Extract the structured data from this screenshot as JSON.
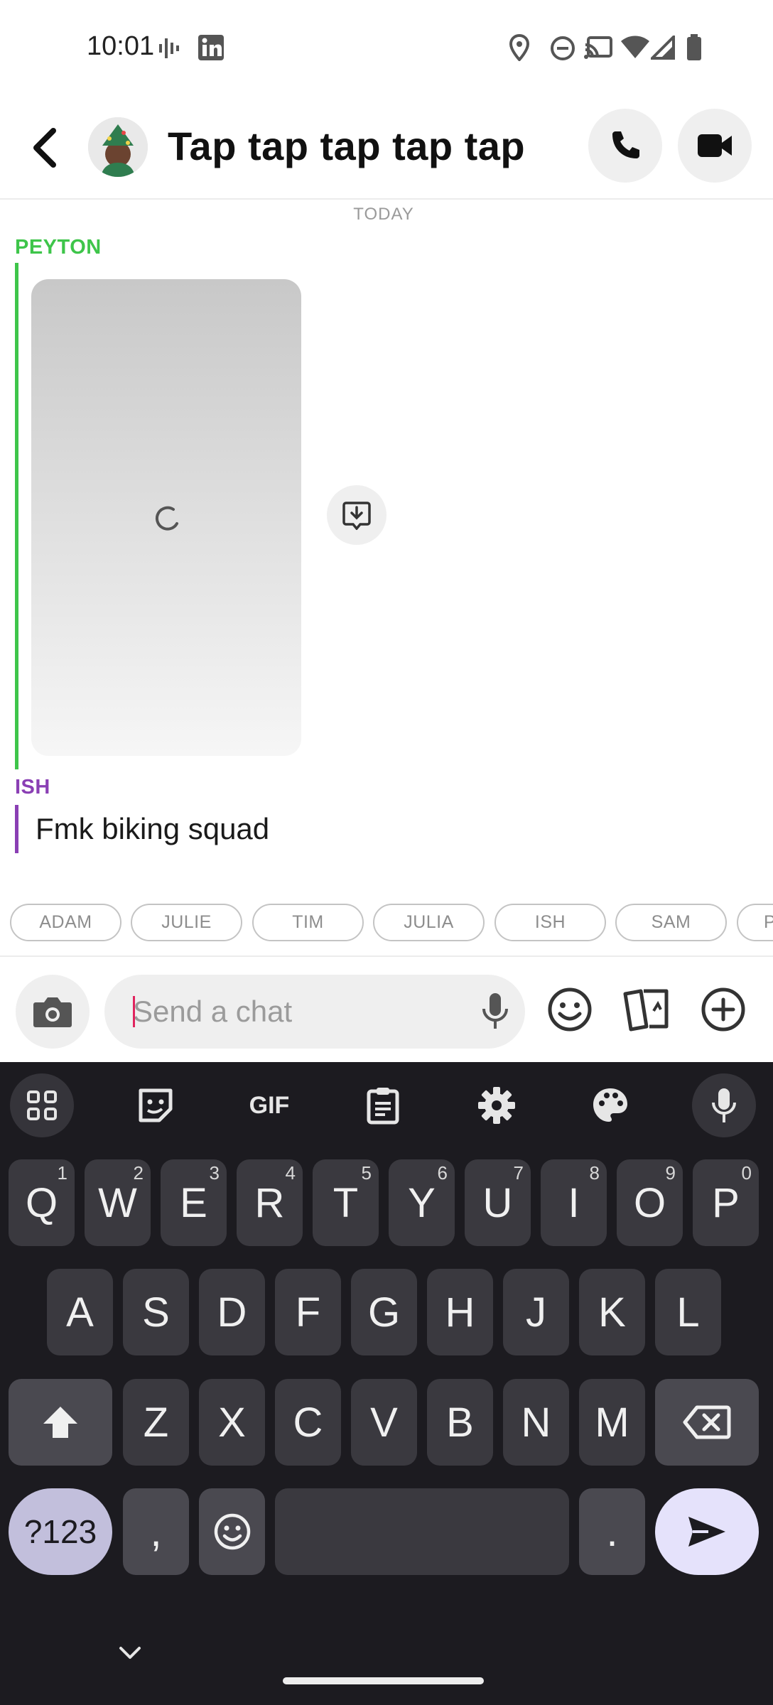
{
  "status_bar": {
    "time": "10:01"
  },
  "header": {
    "title": "Tap tap tap tap tap"
  },
  "chat": {
    "date_divider": "TODAY",
    "messages": [
      {
        "sender": "PEYTON",
        "color": "#3ec54a",
        "type": "media"
      },
      {
        "sender": "ISH",
        "color": "#8a3fb4",
        "type": "text",
        "text": "Fmk biking squad"
      }
    ]
  },
  "mentions": [
    "ADAM",
    "JULIE",
    "TIM",
    "JULIA",
    "ISH",
    "SAM",
    "P"
  ],
  "composer": {
    "placeholder": "Send a chat"
  },
  "keyboard": {
    "toolbar": {
      "gif_label": "GIF"
    },
    "row1": [
      {
        "k": "Q",
        "h": "1"
      },
      {
        "k": "W",
        "h": "2"
      },
      {
        "k": "E",
        "h": "3"
      },
      {
        "k": "R",
        "h": "4"
      },
      {
        "k": "T",
        "h": "5"
      },
      {
        "k": "Y",
        "h": "6"
      },
      {
        "k": "U",
        "h": "7"
      },
      {
        "k": "I",
        "h": "8"
      },
      {
        "k": "O",
        "h": "9"
      },
      {
        "k": "P",
        "h": "0"
      }
    ],
    "row2": [
      "A",
      "S",
      "D",
      "F",
      "G",
      "H",
      "J",
      "K",
      "L"
    ],
    "row3": [
      "Z",
      "X",
      "C",
      "V",
      "B",
      "N",
      "M"
    ],
    "symbols_label": "?123",
    "comma_label": ",",
    "period_label": "."
  },
  "colors": {
    "accent": "#3ec54a",
    "ish": "#8a3fb4",
    "keyboard_bg": "#1c1b20"
  }
}
